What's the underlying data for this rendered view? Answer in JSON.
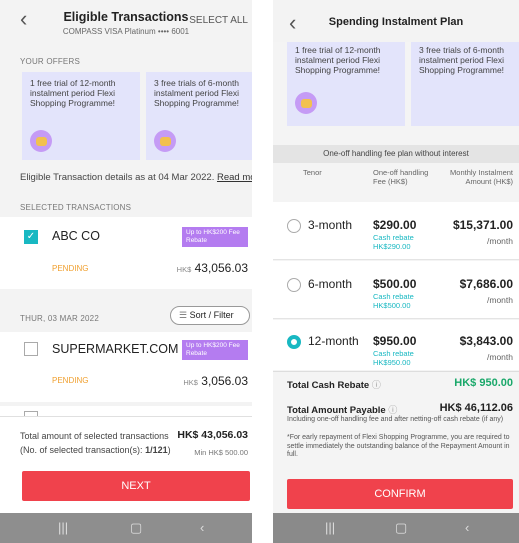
{
  "left": {
    "header": {
      "title": "Eligible Transactions",
      "subtitle": "COMPASS VISA Platinum •••• 6001",
      "select_all": "SELECT ALL"
    },
    "offers_label": "YOUR OFFERS",
    "offers": [
      {
        "text": "1 free trial of 12-month instalment period Flexi Shopping Programme!"
      },
      {
        "text": "3 free trials of 6-month instalment period Flexi Shopping Programme!"
      }
    ],
    "details_text": "Eligible Transaction details as at 04 Mar 2022.",
    "read_more": "Read more",
    "selected_label": "SELECTED TRANSACTIONS",
    "tx1": {
      "merchant": "ABC CO",
      "badge": "Up to HK$200 Fee Rebate",
      "status": "PENDING",
      "currency": "HK$",
      "amount": "43,056.03"
    },
    "date_label": "THUR, 03 MAR 2022",
    "sort_filter": "Sort / Filter",
    "tx2": {
      "merchant": "SUPERMARKET.COM",
      "badge": "Up to HK$200 Fee Rebate",
      "status": "PENDING",
      "currency": "HK$",
      "amount": "3,056.03"
    },
    "footer": {
      "total_label": "Total amount of selected transactions",
      "total_value": "HK$ 43,056.03",
      "count_label": "(No. of selected transaction(s):",
      "count_value": "1/121",
      "min": "Min HK$ 500.00"
    },
    "next_button": "NEXT"
  },
  "right": {
    "header": {
      "title": "Spending Instalment Plan"
    },
    "offers": [
      {
        "text": "1 free trial of 12-month instalment period Flexi Shopping Programme!"
      },
      {
        "text": "3 free trials of 6-month instalment period Flexi Shopping Programme!"
      }
    ],
    "table_title": "One-off handling fee plan without interest",
    "columns": {
      "tenor": "Tenor",
      "fee": "One-off handling Fee (HK$)",
      "monthly": "Monthly Instalment Amount (HK$)"
    },
    "plans": [
      {
        "tenor": "3-month",
        "fee": "$290.00",
        "rebate_label": "Cash rebate",
        "rebate": "HK$290.00",
        "monthly": "$15,371.00",
        "per": "/month",
        "selected": false
      },
      {
        "tenor": "6-month",
        "fee": "$500.00",
        "rebate_label": "Cash rebate",
        "rebate": "HK$500.00",
        "monthly": "$7,686.00",
        "per": "/month",
        "selected": false
      },
      {
        "tenor": "12-month",
        "fee": "$950.00",
        "rebate_label": "Cash rebate",
        "rebate": "HK$950.00",
        "monthly": "$3,843.00",
        "per": "/month",
        "selected": true
      }
    ],
    "total_rebate_label": "Total Cash Rebate",
    "total_rebate": "HK$ 950.00",
    "total_payable_label": "Total Amount Payable",
    "total_payable": "HK$ 46,112.06",
    "note1": "Including one-off handling fee and after netting-off cash rebate (if any)",
    "note2": "*For early repayment of Flexi Shopping Programme, you are required to settle immediately the outstanding balance of the Repayment Amount in full.",
    "confirm_button": "CONFIRM"
  },
  "colors": {
    "accent": "#f0424c",
    "teal": "#18b8c2",
    "green": "#1aa86a",
    "purple": "#b47cf0",
    "offer_bg": "#e3e4fb"
  },
  "icons": {
    "back": "chevron-left-icon",
    "info": "info-icon",
    "sort": "filter-icon",
    "nav": [
      "recent-apps-icon",
      "home-icon",
      "back-nav-icon"
    ]
  }
}
